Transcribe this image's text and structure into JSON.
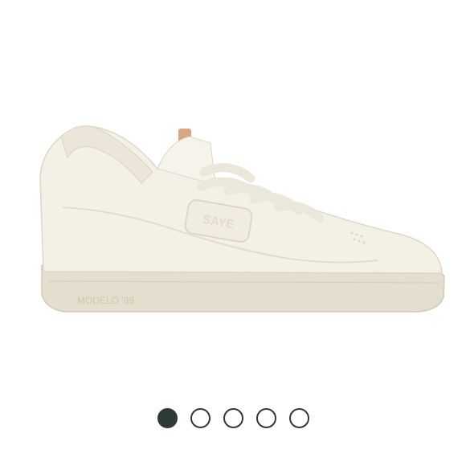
{
  "product": {
    "image_name": "white-sneaker-side-view",
    "midsole_text": "MODELO '89",
    "side_logo_text": "SAYE"
  },
  "carousel": {
    "total": 5,
    "active_index": 0,
    "active_color": "#2f3a35",
    "inactive_color": "#ffffff"
  },
  "colors": {
    "upper": "#f3f0e6",
    "sole": "#e4decf",
    "heel_tab": "#d9a77f"
  }
}
